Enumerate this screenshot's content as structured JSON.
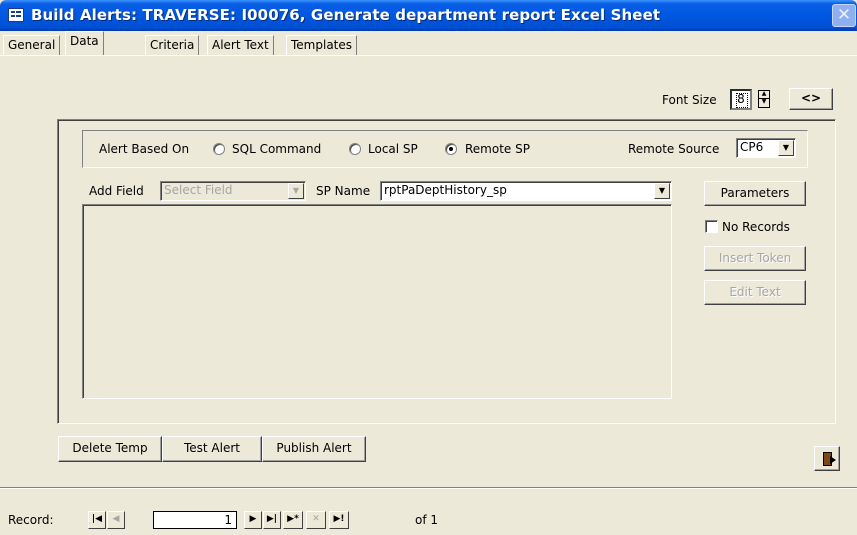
{
  "window": {
    "title": "Build Alerts: TRAVERSE: I00076, Generate department report Excel Sheet",
    "close_symbol": "✕"
  },
  "tabs": [
    {
      "label": "General",
      "active": false
    },
    {
      "label": "Data",
      "active": true
    },
    {
      "label": "Criteria",
      "active": false
    },
    {
      "label": "Alert Text",
      "active": false
    },
    {
      "label": "Templates",
      "active": false
    }
  ],
  "font_size": {
    "label": "Font Size",
    "value": "8",
    "toggle_button": "<>"
  },
  "alert_based_on": {
    "label": "Alert Based On",
    "options": [
      {
        "label": "SQL Command",
        "checked": false
      },
      {
        "label": "Local SP",
        "checked": false
      },
      {
        "label": "Remote SP",
        "checked": true
      }
    ],
    "remote_source_label": "Remote Source",
    "remote_source_value": "CP6"
  },
  "fields": {
    "add_field_label": "Add Field",
    "add_field_placeholder": "Select Field",
    "sp_name_label": "SP Name",
    "sp_name_value": "rptPaDeptHistory_sp",
    "sql_text": ""
  },
  "side_buttons": {
    "parameters": "Parameters",
    "no_records": "No Records",
    "no_records_checked": false,
    "insert_token": "Insert Token",
    "edit_text": "Edit Text"
  },
  "bottom_buttons": {
    "delete_temp": "Delete Temp",
    "test_alert": "Test Alert",
    "publish_alert": "Publish Alert"
  },
  "record_nav": {
    "label": "Record:",
    "current": "1",
    "of_text": "of  1"
  }
}
